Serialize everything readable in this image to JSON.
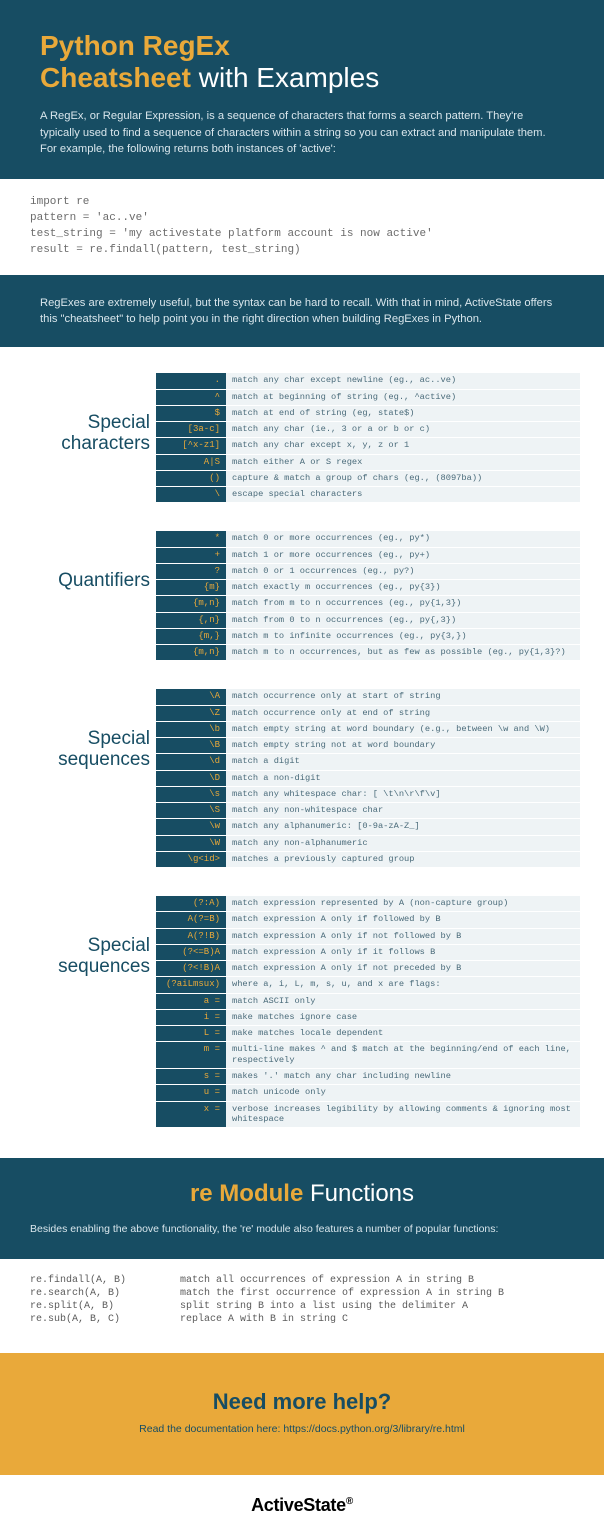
{
  "hero": {
    "title_line1": "Python RegEx",
    "title_bold": "Cheatsheet",
    "title_rest": "with Examples",
    "intro": "A RegEx, or Regular Expression, is a sequence of characters that forms a search pattern. They're typically used to find a sequence of characters within a string so you can extract and manipulate them. For example, the following returns both instances of 'active':"
  },
  "code_example": "import re\npattern = 'ac..ve'\ntest_string = 'my activestate platform account is now active'\nresult = re.findall(pattern, test_string)",
  "note": "RegExes are extremely useful, but the syntax can be hard to recall. With that in mind, ActiveState offers this \"cheatsheet\" to help point you in the right direction when building RegExes in Python.",
  "sections": [
    {
      "title": "Special\ncharacters",
      "rows": [
        {
          "s": ".",
          "d": "match any char except newline (eg., ac..ve)"
        },
        {
          "s": "^",
          "d": "match at beginning of string (eg., ^active)"
        },
        {
          "s": "$",
          "d": "match at end of string (eg, state$)"
        },
        {
          "s": "[3a-c]",
          "d": "match any char (ie., 3 or a or b or c)"
        },
        {
          "s": "[^x-z1]",
          "d": "match any char except x, y, z or 1"
        },
        {
          "s": "A|S",
          "d": "match either A or S regex"
        },
        {
          "s": "()",
          "d": "capture & match a group of chars (eg., (8097ba))"
        },
        {
          "s": "\\",
          "d": "escape special characters"
        }
      ]
    },
    {
      "title": "Quantifiers",
      "rows": [
        {
          "s": "*",
          "d": "match 0 or more occurrences (eg., py*)"
        },
        {
          "s": "+",
          "d": "match 1 or more occurrences (eg., py+)"
        },
        {
          "s": "?",
          "d": "match 0 or 1 occurrences (eg., py?)"
        },
        {
          "s": "{m}",
          "d": "match exactly m occurrences (eg., py{3})"
        },
        {
          "s": "{m,n}",
          "d": "match from m to n occurrences (eg., py{1,3})"
        },
        {
          "s": "{,n}",
          "d": "match from 0 to n occurrences (eg., py{,3})"
        },
        {
          "s": "{m,}",
          "d": "match m to infinite occurrences (eg., py{3,})"
        },
        {
          "s": "{m,n}",
          "d": "match m to n occurrences, but as few as possible (eg., py{1,3}?)"
        }
      ]
    },
    {
      "title": "Special\nsequences",
      "rows": [
        {
          "s": "\\A",
          "d": "match occurrence only at start of string"
        },
        {
          "s": "\\Z",
          "d": "match occurrence only at end of string"
        },
        {
          "s": "\\b",
          "d": "match empty string at word boundary (e.g., between \\w and \\W)"
        },
        {
          "s": "\\B",
          "d": "match empty string not at word boundary"
        },
        {
          "s": "\\d",
          "d": "match a digit"
        },
        {
          "s": "\\D",
          "d": "match a non-digit"
        },
        {
          "s": "\\s",
          "d": "match any whitespace char: [ \\t\\n\\r\\f\\v]"
        },
        {
          "s": "\\S",
          "d": "match any non-whitespace char"
        },
        {
          "s": "\\w",
          "d": "match any alphanumeric: [0-9a-zA-Z_]"
        },
        {
          "s": "\\W",
          "d": "match any non-alphanumeric"
        },
        {
          "s": "\\g<id>",
          "d": "matches a previously captured group"
        }
      ]
    },
    {
      "title": "Special\nsequences",
      "rows": [
        {
          "s": "(?:A)",
          "d": "match expression represented by A (non-capture group)"
        },
        {
          "s": "A(?=B)",
          "d": "match expression A only if followed by B"
        },
        {
          "s": "A(?!B)",
          "d": " match expression A only if not followed by B"
        },
        {
          "s": "(?<=B)A",
          "d": " match expression A only if it follows B"
        },
        {
          "s": "(?<!B)A",
          "d": "match expression A only if not preceded by B"
        },
        {
          "s": "(?aiLmsux)",
          "d": "where a, i, L, m, s, u, and x are flags:"
        },
        {
          "s": "a =",
          "d": "match ASCII only"
        },
        {
          "s": "i =",
          "d": "make matches ignore case"
        },
        {
          "s": "L =",
          "d": "make matches locale dependent"
        },
        {
          "s": "m =",
          "d": "multi-line makes ^ and $ match at the beginning/end of each line, respectively"
        },
        {
          "s": "s =",
          "d": "makes '.' match any char including newline"
        },
        {
          "s": "u =",
          "d": "match unicode only"
        },
        {
          "s": "x =",
          "d": "verbose increases legibility by allowing comments & ignoring most whitespace"
        }
      ]
    }
  ],
  "module": {
    "title_bold": "re Module",
    "title_rest": "Functions",
    "intro": "Besides enabling the above functionality, the 're' module also features a number of popular functions:",
    "funcs": [
      {
        "c": "re.findall(A, B)",
        "d": "match all occurrences of expression A in string B"
      },
      {
        "c": "re.search(A, B)",
        "d": "match the first occurrence of expression A in string B"
      },
      {
        "c": "re.split(A, B)",
        "d": "split string B into a list using the delimiter A"
      },
      {
        "c": "re.sub(A, B, C)",
        "d": "replace A with B in string C"
      }
    ]
  },
  "help": {
    "title": "Need more help?",
    "text": "Read the documentation here: https://docs.python.org/3/library/re.html"
  },
  "footer": {
    "brand": "ActiveState"
  }
}
